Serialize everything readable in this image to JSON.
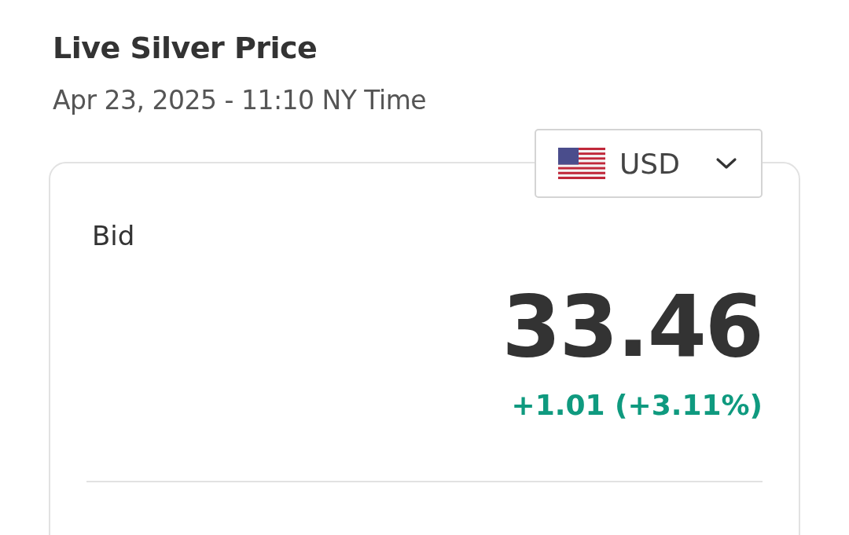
{
  "header": {
    "title": "Live Silver Price",
    "timestamp": "Apr 23, 2025 - 11:10 NY Time"
  },
  "currency_select": {
    "value": "USD"
  },
  "quote": {
    "label": "Bid",
    "price": "33.46",
    "change": "+1.01 (+3.11%)",
    "positive": true
  }
}
